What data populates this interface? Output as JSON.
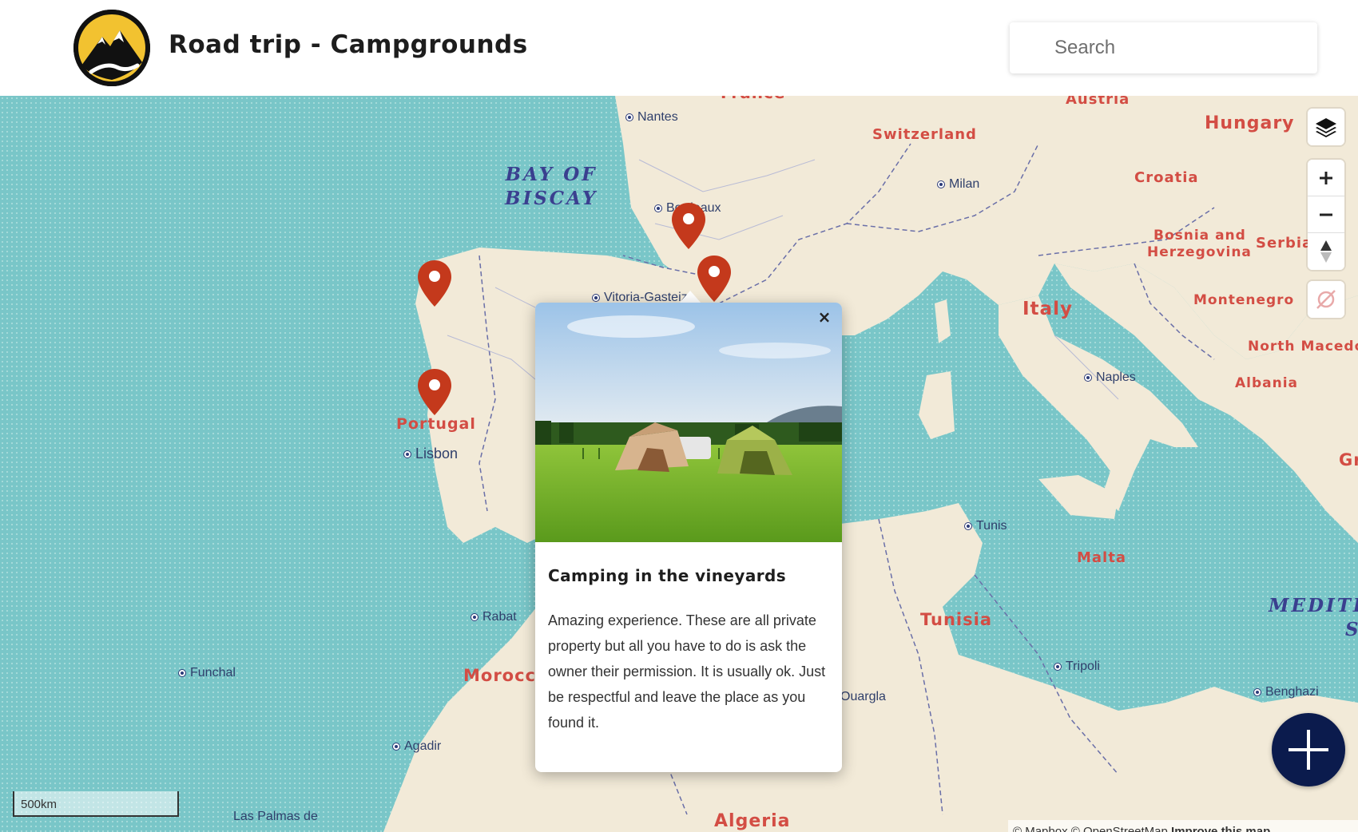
{
  "header": {
    "title": "Road trip - Campgrounds",
    "search_placeholder": "Search"
  },
  "map": {
    "sea_labels": [
      {
        "line1": "BAY OF",
        "line2": "BISCAY"
      },
      {
        "line1": "MEDITE",
        "line2": "S"
      }
    ],
    "country_labels": [
      "France",
      "Austria",
      "Hungary",
      "Switzerland",
      "Croatia",
      "Bosnia and",
      "Herzegovina",
      "Serbia",
      "Italy",
      "Montenegro",
      "North Macedonia",
      "Albania",
      "Portugal",
      "Gr",
      "Malta",
      "Tunisia",
      "Morocco",
      "Algeria"
    ],
    "city_labels": [
      "Nantes",
      "Bordeaux",
      "Milan",
      "Vitoria-Gasteiz",
      "Naples",
      "Lisbon",
      "Tunis",
      "Rabat",
      "Funchal",
      "Tripoli",
      "Benghazi",
      "Ouargla",
      "Agadir",
      "Las Palmas de"
    ],
    "scale_label": "500km",
    "attribution": {
      "text": "© Mapbox © OpenStreetMap ",
      "link": "Improve this map"
    },
    "colors": {
      "water": "#79c6c8",
      "land": "#f2ead8",
      "marker": "#c4391c",
      "fab": "#0b1b4d",
      "country_text": "#d34d44"
    }
  },
  "popup": {
    "title": "Camping in the vineyards",
    "description": "Amazing experience. These are all private property but all you have to do is ask the owner their permission. It is usually ok. Just be respectful and leave the place as you found it.",
    "close_label": "×"
  },
  "controls": {
    "icons": [
      "layers-icon",
      "zoom-in-icon",
      "zoom-out-icon",
      "compass-icon",
      "geolocate-off-icon",
      "add-icon"
    ]
  }
}
